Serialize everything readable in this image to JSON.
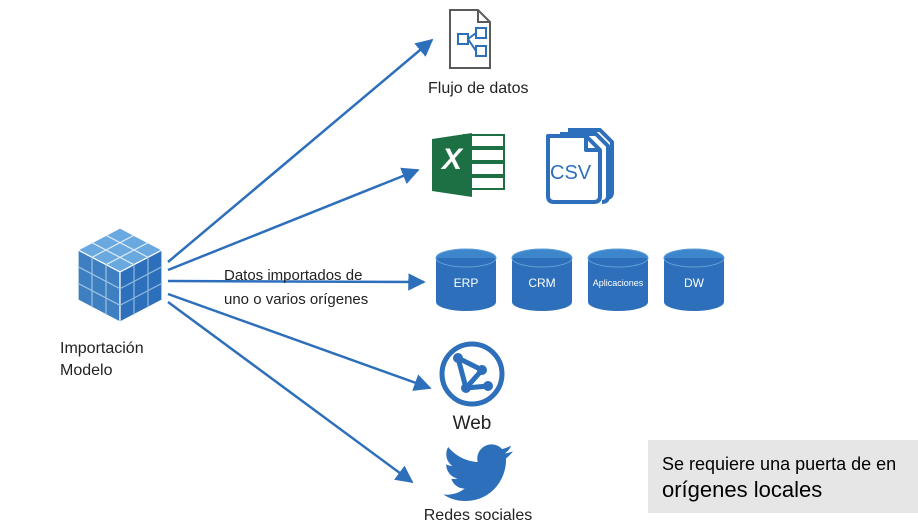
{
  "colors": {
    "accent": "#2d6fba",
    "excel_green": "#1d7044",
    "note_bg": "#e6e6e6"
  },
  "source": {
    "title_line1": "Importación",
    "title_line2": "Modelo"
  },
  "edge_label": {
    "line1": "Datos importados de",
    "line2": "uno o varios orígenes"
  },
  "targets": {
    "dataflow": {
      "label": "Flujo de datos"
    },
    "excel_csv": {
      "excel_letter": "X",
      "csv_text": "CSV"
    },
    "databases": {
      "items": [
        {
          "name": "ERP"
        },
        {
          "name": "CRM"
        },
        {
          "name": "Aplicaciones"
        },
        {
          "name": "DW"
        }
      ]
    },
    "web": {
      "label": "Web"
    },
    "social": {
      "label": "Redes sociales"
    }
  },
  "note": {
    "line1": "Se requiere una puerta de en",
    "line2": "orígenes locales"
  }
}
